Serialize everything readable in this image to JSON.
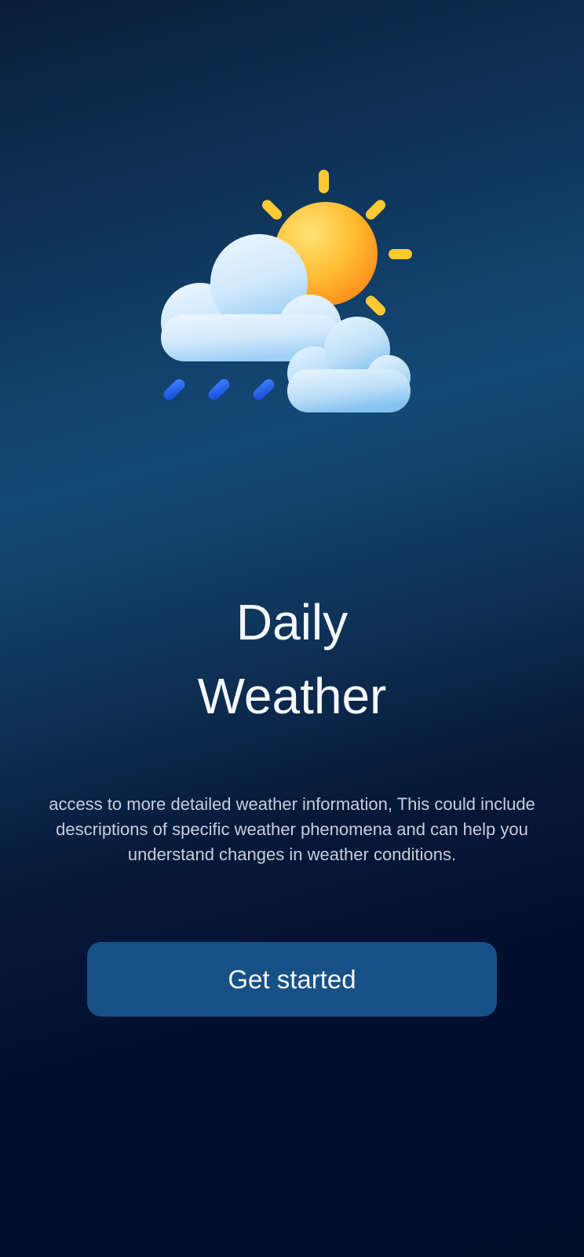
{
  "onboarding": {
    "hero_icon": "partly-cloudy-rain-icon",
    "title_line1": "Daily",
    "title_line2": "Weather",
    "description": "access to more detailed weather information, This could include descriptions of specific weather phenomena and can help you understand changes in weather conditions.",
    "cta_label": "Get started"
  },
  "colors": {
    "background_top": "#0a1e3c",
    "background_mid": "#134a76",
    "background_bottom": "#020d2a",
    "button": "#175185",
    "title_text": "#f4f6fa",
    "body_text": "#c7cfdc",
    "sun": "#ffb020",
    "sun_rays": "#ffc933",
    "cloud": "#cfe8fb",
    "rain": "#1e6bff"
  }
}
